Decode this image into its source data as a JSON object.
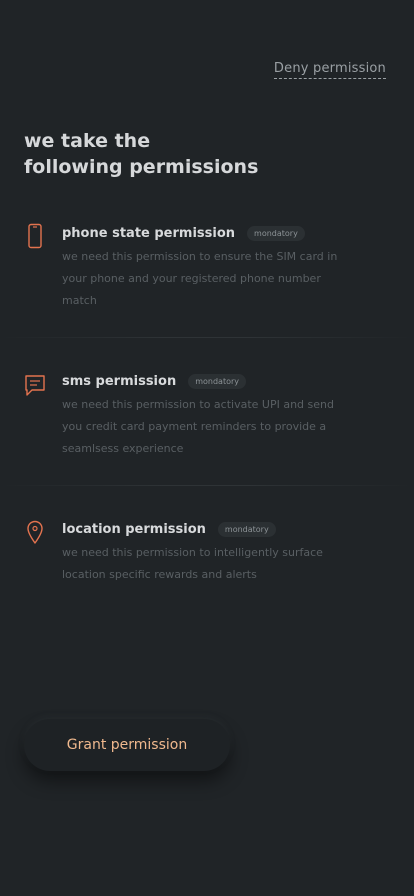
{
  "header": {
    "deny_label": "Deny permission",
    "heading_line1": "we take the",
    "heading_line2": "following permissions"
  },
  "permissions": [
    {
      "title": "phone state permission",
      "badge": "mondatory",
      "description": "we need this permission to ensure the SIM card in your phone and your registered phone number match",
      "icon": "phone-icon"
    },
    {
      "title": "sms permission",
      "badge": "mondatory",
      "description": "we need this permission to activate UPI and send you credit card payment reminders to provide a seamlsess experience",
      "icon": "message-icon"
    },
    {
      "title": "location permission",
      "badge": "mondatory",
      "description": "we need this permission to intelligently surface location specific rewards and alerts",
      "icon": "location-pin-icon"
    }
  ],
  "footer": {
    "grant_label": "Grant permission"
  },
  "colors": {
    "background": "#202427",
    "accent": "#e3734f",
    "grant_text": "#f0b98e"
  }
}
